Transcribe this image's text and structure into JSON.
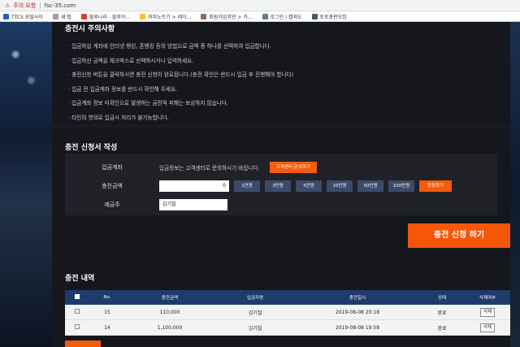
{
  "browser": {
    "warning": "주의 요함",
    "url": "fsc-35.com",
    "bookmarks": [
      {
        "label": "TTCS 포털사이",
        "color": "#1565c0"
      },
      {
        "label": "새 탭",
        "color": "#9e9e9e"
      },
      {
        "label": "블루나라 - 블루야...",
        "color": "#e53935"
      },
      {
        "label": "커피노트기 > 레이...",
        "color": "#fbc02d"
      },
      {
        "label": "회원가입약관 > 카...",
        "color": "#8d6e63"
      },
      {
        "label": "로그인 | 캡쳐도",
        "color": "#607d8b"
      },
      {
        "label": "토토총판모집",
        "color": "#455a64"
      }
    ]
  },
  "notice": {
    "title": "충전시 주의사항",
    "items": [
      "입금하실 계좌에 인터넷 뱅킹, 폰뱅킹 등의 방법으로 금액 중 하나를 선택하여 입금합니다.",
      "입금하신 금액을 체크박스로 선택하시거나 입력하세요.",
      "충전신청 버튼을 클릭하시면 충전 신청이 완료됩니다.(충전 확인은 반드시 입금 후 진행해야 합니다)",
      "입금 전 입금계좌 정보를 반드시 확인해 주세요.",
      "입금계좌 정보 미확인으로 발생하는 금전적 피해는 보상하지 않습니다.",
      "타인의 명의로 입금시 처리가 불가능합니다."
    ]
  },
  "form": {
    "title": "충전 신청서 작성",
    "account_label": "입금계좌",
    "account_text": "입금정보는 고객센터로 문의하시기 바랍니다.",
    "account_button": "고객센터 문의하기",
    "amount_label": "충전금액",
    "amount_value": "0",
    "chips": [
      "1만원",
      "3만원",
      "5만원",
      "10만원",
      "50만원",
      "100만원"
    ],
    "reset_label": "정정하기",
    "depositor_label": "예금주",
    "depositor_value": "김기철",
    "submit_label": "충전 신청 하기"
  },
  "history": {
    "title": "충전 내역",
    "columns": [
      "No.",
      "충전금액",
      "입금자명",
      "충전일시",
      "상태",
      "삭제여부"
    ],
    "rows": [
      {
        "no": "15",
        "amount": "110,000",
        "name": "김기철",
        "datetime": "2019-08-08 20:18",
        "status": "완료",
        "action": "삭제"
      },
      {
        "no": "14",
        "amount": "1,100,000",
        "name": "김기철",
        "datetime": "2019-08-08 19:58",
        "status": "완료",
        "action": "삭제"
      }
    ]
  },
  "colors": {
    "accent": "#f35b0d",
    "table_header": "#1f3b6b",
    "chip": "#3b4b68"
  }
}
